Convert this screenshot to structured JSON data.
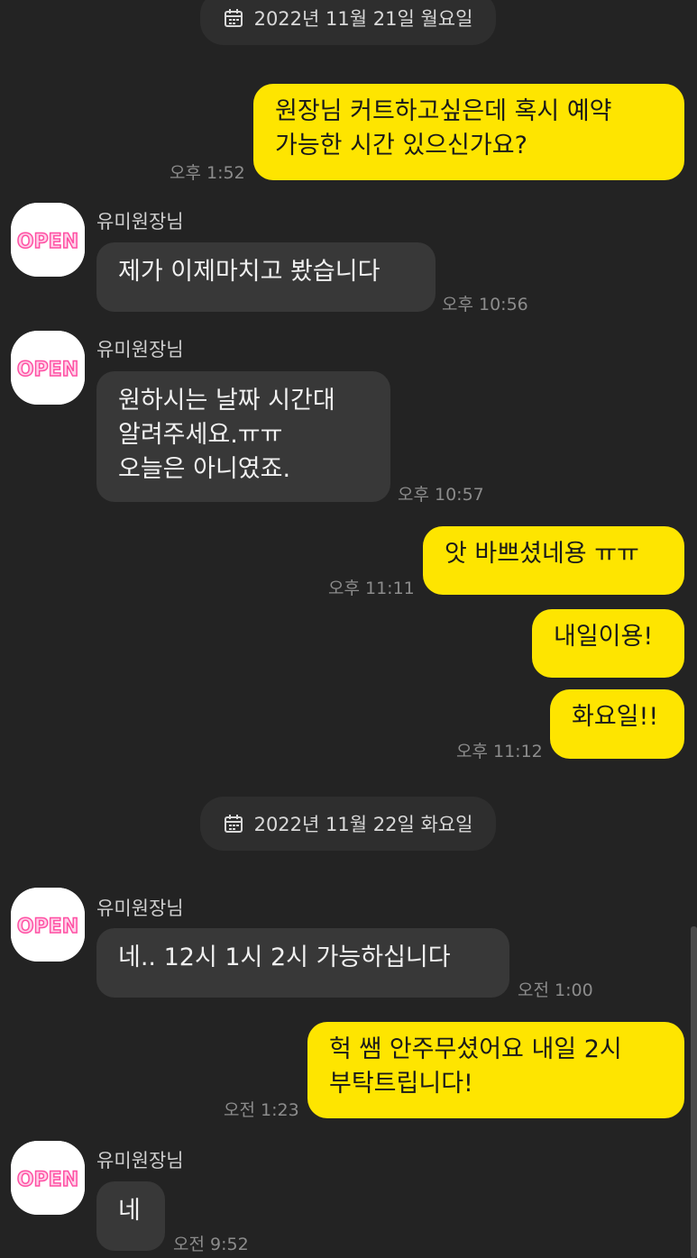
{
  "dates": {
    "first": "2022년 11월 21일 월요일",
    "second": "2022년 11월 22일 화요일"
  },
  "contact": {
    "name": "유미원장님",
    "avatar_text": "OPEN",
    "avatar_color": "#ff4fa3"
  },
  "colors": {
    "my_bubble": "#fee500",
    "their_bubble": "#383838",
    "background": "#232323"
  },
  "messages": [
    {
      "from": "me",
      "text": "원장님 커트하고싶은데 혹시 예약\n가능한 시간 있으신가요?",
      "time": "오후 1:52"
    },
    {
      "from": "them",
      "text": "제가 이제마치고 봤습니다",
      "time": "오후 10:56"
    },
    {
      "from": "them",
      "text": "원하시는 날짜 시간대\n알려주세요.ㅠㅠ\n오늘은 아니였죠.",
      "time": "오후 10:57"
    },
    {
      "from": "me",
      "text": "앗 바쁘셨네용 ㅠㅠ",
      "time": "오후 11:11"
    },
    {
      "from": "me",
      "text": "내일이용!",
      "time": ""
    },
    {
      "from": "me",
      "text": "화요일!!",
      "time": "오후 11:12"
    },
    {
      "from": "them",
      "text": "네.. 12시 1시 2시 가능하십니다",
      "time": "오전 1:00"
    },
    {
      "from": "me",
      "text": "헉 쌤 안주무셨어요 내일 2시\n부탁트립니다!",
      "time": "오전 1:23"
    },
    {
      "from": "them",
      "text": "네",
      "time": "오전 9:52"
    }
  ]
}
